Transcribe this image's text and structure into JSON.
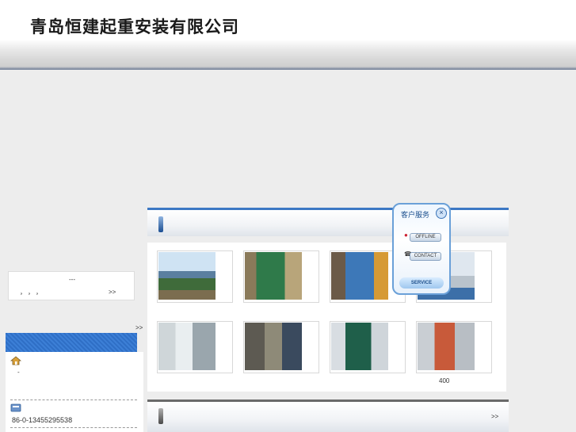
{
  "header": {
    "company_name": "青岛恒建起重安装有限公司"
  },
  "left_notice": {
    "title": "---",
    "text": "，，，",
    "more": ">>"
  },
  "left_more": ">>",
  "contact": {
    "line1": "-",
    "phone": "86-0-13455295538"
  },
  "products": {
    "more": ">>",
    "count_label": "400",
    "items": [
      {
        "image": "crane-lifting-equipment-outdoor"
      },
      {
        "image": "green-machinery-workshop"
      },
      {
        "image": "blue-machinery-installation"
      },
      {
        "image": "crane-machine-building"
      },
      {
        "image": "workers-cleanroom"
      },
      {
        "image": "workers-loading-parts"
      },
      {
        "image": "press-machine-blue-frame"
      },
      {
        "image": "large-press-installation"
      }
    ]
  },
  "qq_widget": {
    "title": "客户服务",
    "close_icon": "close-icon",
    "offline": "OFFLINE",
    "contact": "CONTACT",
    "service": "SERVICE"
  },
  "colors": {
    "accent_blue": "#3c78c4",
    "header_line": "#6c7a94"
  }
}
